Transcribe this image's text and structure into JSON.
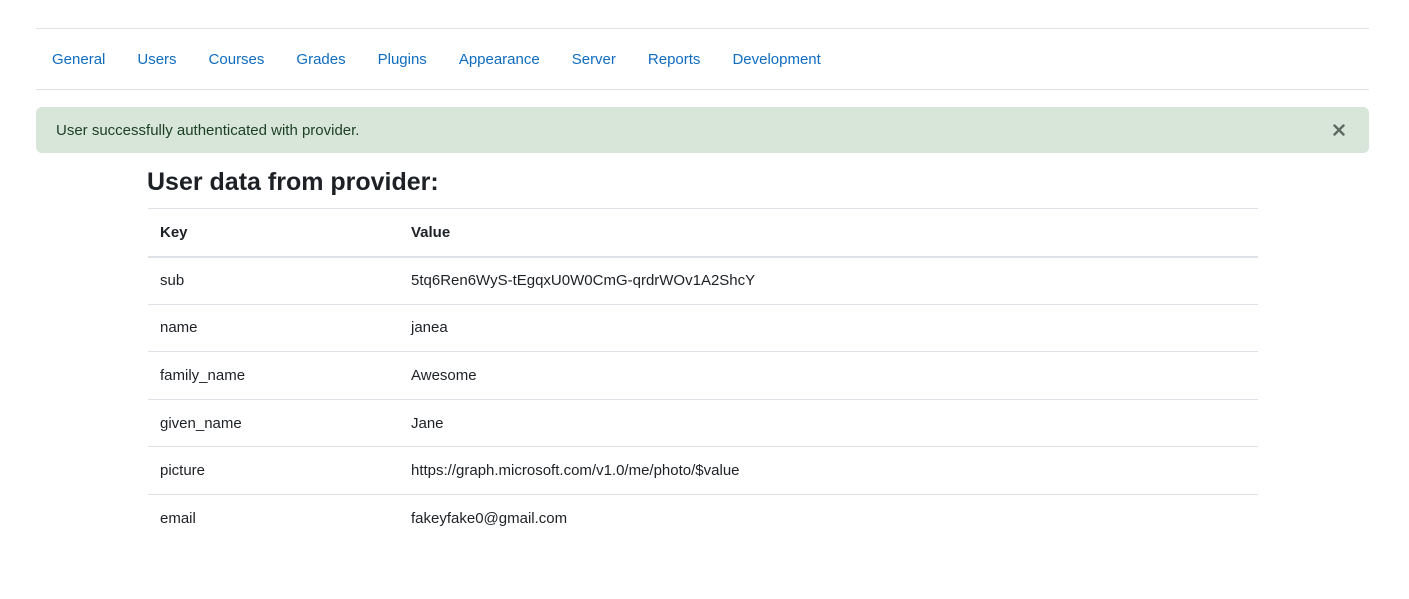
{
  "nav": {
    "tabs": [
      {
        "label": "General"
      },
      {
        "label": "Users"
      },
      {
        "label": "Courses"
      },
      {
        "label": "Grades"
      },
      {
        "label": "Plugins"
      },
      {
        "label": "Appearance"
      },
      {
        "label": "Server"
      },
      {
        "label": "Reports"
      },
      {
        "label": "Development"
      }
    ]
  },
  "alert": {
    "message": "User successfully authenticated with provider.",
    "close_icon": "close-icon"
  },
  "main": {
    "heading": "User data from provider:",
    "table": {
      "headers": {
        "key": "Key",
        "value": "Value"
      },
      "rows": [
        {
          "key": "sub",
          "value": "5tq6Ren6WyS-tEgqxU0W0CmG-qrdrWOv1A2ShcY"
        },
        {
          "key": "name",
          "value": "janea"
        },
        {
          "key": "family_name",
          "value": "Awesome"
        },
        {
          "key": "given_name",
          "value": "Jane"
        },
        {
          "key": "picture",
          "value": "https://graph.microsoft.com/v1.0/me/photo/$value"
        },
        {
          "key": "email",
          "value": "fakeyfake0@gmail.com"
        }
      ]
    }
  },
  "colors": {
    "link": "#0f6cbf",
    "alert_bg": "#d7e6d9",
    "alert_text": "#1c3f24",
    "border": "#dee2e6"
  }
}
